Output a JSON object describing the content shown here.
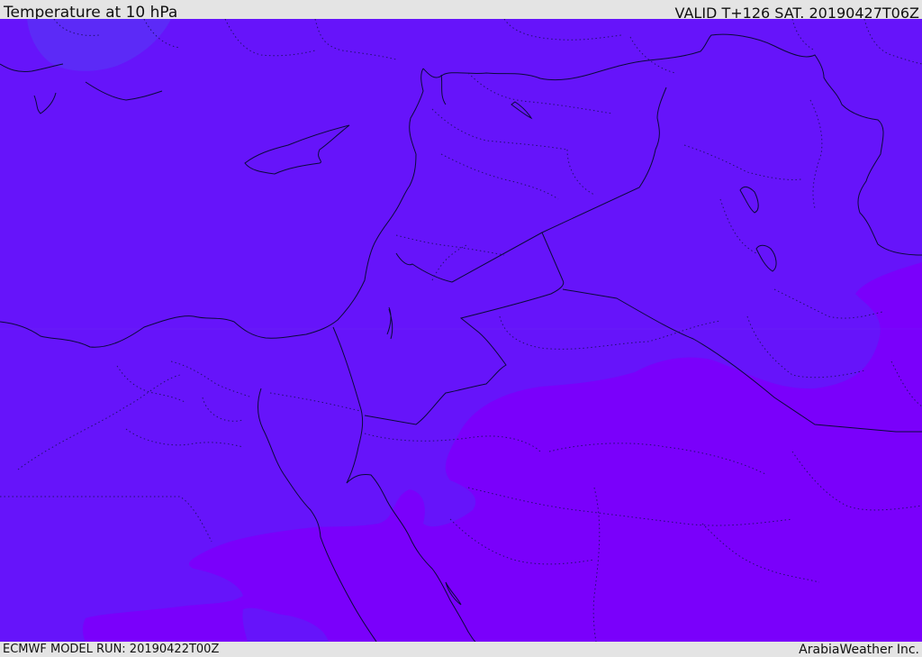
{
  "header": {
    "title": "Temperature at 10 hPa",
    "valid_time": "VALID T+126 SAT. 20190427T06Z"
  },
  "footer": {
    "model_run": "ECMWF MODEL RUN: 20190422T00Z",
    "credit": "ArabiaWeather Inc."
  },
  "colors": {
    "bar_background": "#e4e4e4",
    "field_base": "#6614fa",
    "field_warm": "#7a00fb",
    "field_cool": "#5a2cf6",
    "coastline": "#0a0a3a",
    "border_dotted": "#1a1060"
  }
}
